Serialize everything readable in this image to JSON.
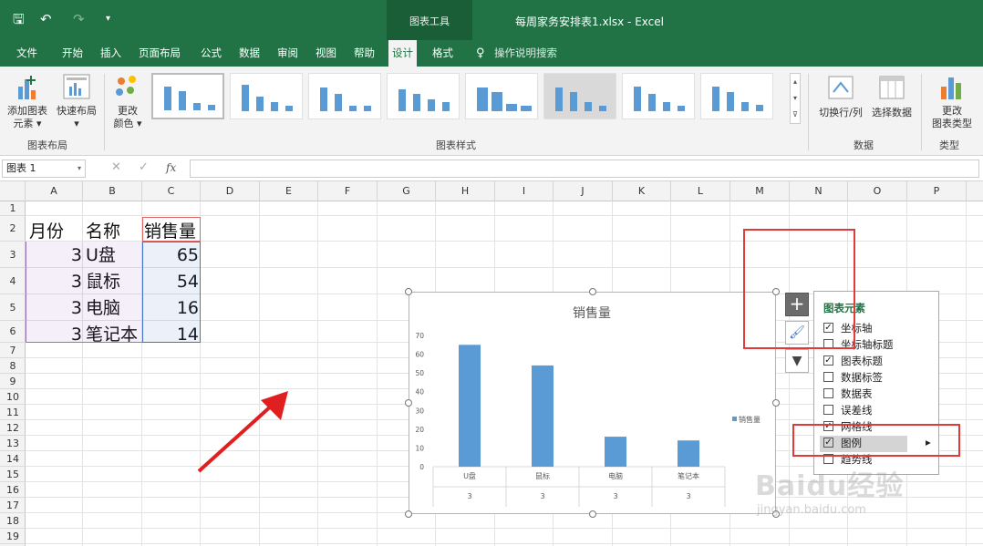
{
  "title_bar": {
    "context_tools": "图表工具",
    "doc_title": "每周家务安排表1.xlsx  -  Excel"
  },
  "tabs": [
    "文件",
    "开始",
    "插入",
    "页面布局",
    "公式",
    "数据",
    "审阅",
    "视图",
    "帮助",
    "设计",
    "格式"
  ],
  "active_tab": "设计",
  "tell_me": "操作说明搜索",
  "ribbon": {
    "add_element": [
      "添加图表",
      "元素 ▾"
    ],
    "quick_layout": "快速布局",
    "quick_layout_arrow": "▾",
    "change_colors": [
      "更改",
      "颜色 ▾"
    ],
    "group_layout": "图表布局",
    "group_styles": "图表样式",
    "switch_rowcol": "切换行/列",
    "select_data": "选择数据",
    "group_data": "数据",
    "change_type": [
      "更改",
      "图表类型"
    ],
    "group_type": "类型"
  },
  "formula_bar": {
    "name_box": "图表 1",
    "fx": "fx"
  },
  "columns": [
    "A",
    "B",
    "C",
    "D",
    "E",
    "F",
    "G",
    "H",
    "I",
    "J",
    "K",
    "L",
    "M",
    "N",
    "O",
    "P"
  ],
  "rows": [
    "1",
    "2",
    "3",
    "4",
    "5",
    "6",
    "7",
    "8",
    "9",
    "10",
    "11",
    "12",
    "13",
    "14",
    "15",
    "16",
    "17",
    "18",
    "19"
  ],
  "sheet": {
    "headers": [
      "月份",
      "名称",
      "销售量"
    ],
    "rows": [
      [
        "3",
        "U盘",
        "65"
      ],
      [
        "3",
        "鼠标",
        "54"
      ],
      [
        "3",
        "电脑",
        "16"
      ],
      [
        "3",
        "笔记本",
        "14"
      ]
    ]
  },
  "chart_data": {
    "type": "bar",
    "title": "销售量",
    "categories": [
      "U盘",
      "鼠标",
      "电脑",
      "笔记本"
    ],
    "sub_categories": [
      "3",
      "3",
      "3",
      "3"
    ],
    "series": [
      {
        "name": "销售量",
        "values": [
          65,
          54,
          16,
          14
        ],
        "color": "#5b9bd5"
      }
    ],
    "ylim": [
      0,
      70
    ],
    "yticks": [
      "0",
      "10",
      "20",
      "30",
      "40",
      "50",
      "60",
      "70"
    ],
    "legend": "right",
    "grid": false
  },
  "chart_elements_panel": {
    "title": "图表元素",
    "items": [
      {
        "label": "坐标轴",
        "checked": true
      },
      {
        "label": "坐标轴标题",
        "checked": false
      },
      {
        "label": "图表标题",
        "checked": true
      },
      {
        "label": "数据标签",
        "checked": false
      },
      {
        "label": "数据表",
        "checked": false
      },
      {
        "label": "误差线",
        "checked": false
      },
      {
        "label": "网格线",
        "checked": true
      },
      {
        "label": "图例",
        "checked": true
      },
      {
        "label": "趋势线",
        "checked": false
      }
    ],
    "arrow": "▸"
  },
  "watermark": {
    "brand": "Baidu经验",
    "url": "jingyan.baidu.com"
  },
  "colors": {
    "excel_green": "#217346",
    "bar_blue": "#5b9bd5",
    "highlight_red": "#e03a3a"
  }
}
